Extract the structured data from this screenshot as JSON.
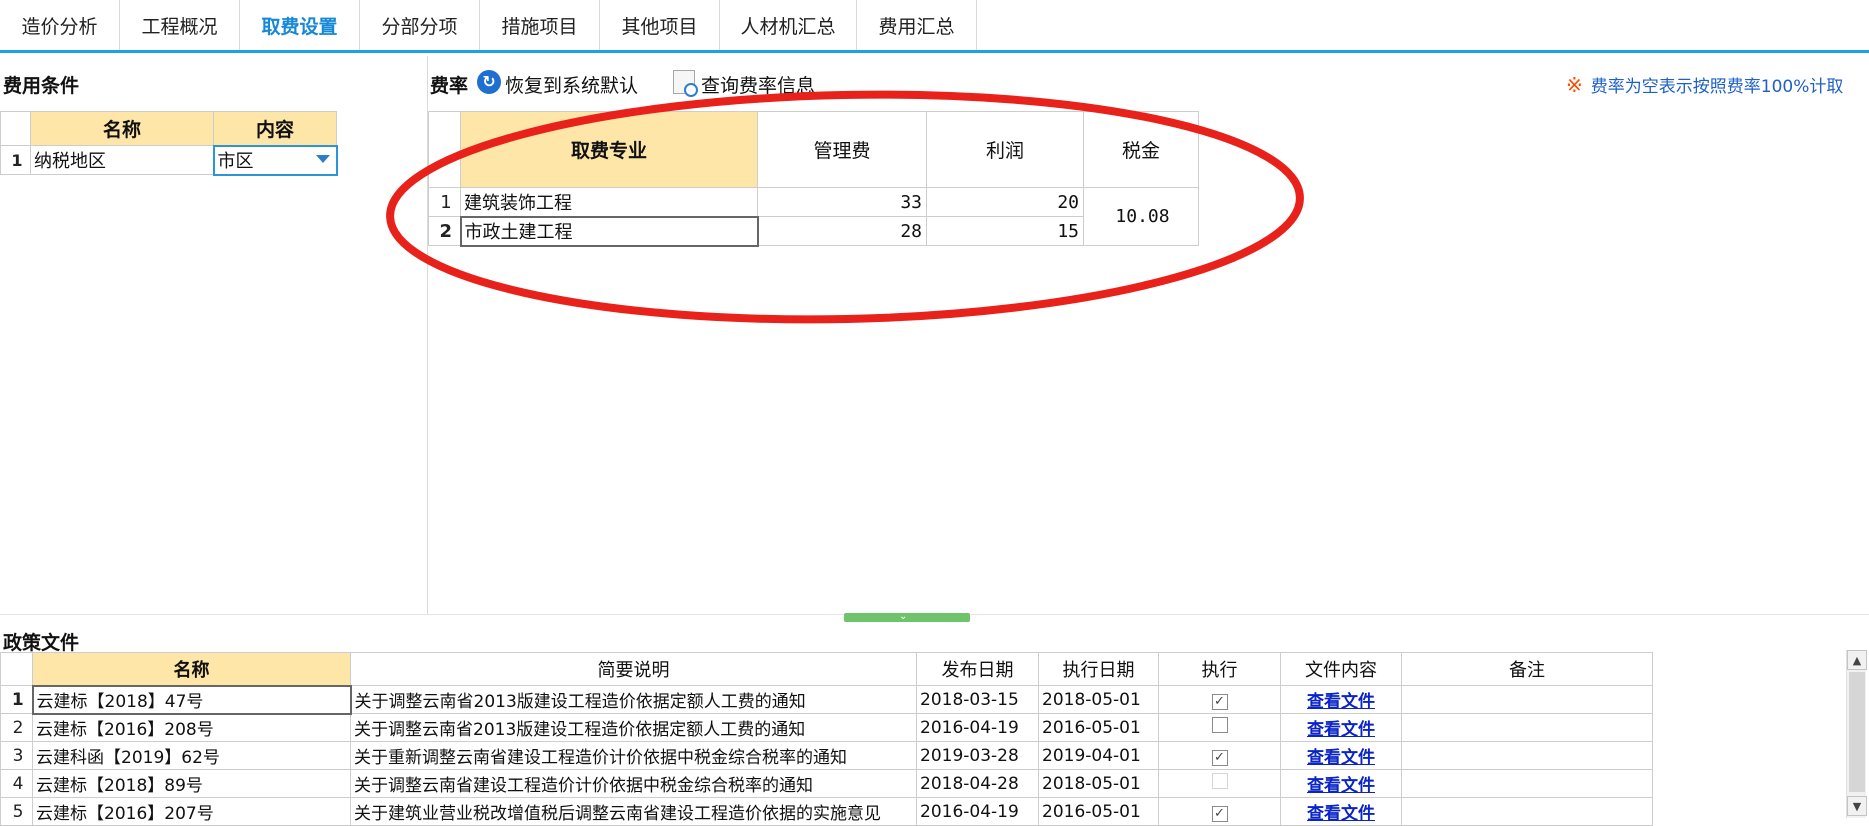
{
  "tabs": [
    {
      "label": "造价分析"
    },
    {
      "label": "工程概况"
    },
    {
      "label": "取费设置"
    },
    {
      "label": "分部分项"
    },
    {
      "label": "措施项目"
    },
    {
      "label": "其他项目"
    },
    {
      "label": "人材机汇总"
    },
    {
      "label": "费用汇总"
    }
  ],
  "active_tab": "取费设置",
  "conditions": {
    "title": "费用条件",
    "headers": {
      "name": "名称",
      "content": "内容"
    },
    "rows": [
      {
        "num": "1",
        "name": "纳税地区",
        "content": "市区"
      }
    ]
  },
  "rates": {
    "title": "费率",
    "reset_label": "恢复到系统默认",
    "query_label": "查询费率信息",
    "note_mark": "※",
    "note": "费率为空表示按照费率100%计取",
    "headers": {
      "specialty": "取费专业",
      "mgmt": "管理费",
      "profit": "利润",
      "tax": "税金"
    },
    "rows": [
      {
        "num": "1",
        "specialty": "建筑装饰工程",
        "mgmt": "33",
        "profit": "20"
      },
      {
        "num": "2",
        "specialty": "市政土建工程",
        "mgmt": "28",
        "profit": "15"
      }
    ],
    "tax_value": "10.08"
  },
  "policy": {
    "title": "政策文件",
    "headers": {
      "name": "名称",
      "summary": "简要说明",
      "publish": "发布日期",
      "effective": "执行日期",
      "execute": "执行",
      "content": "文件内容",
      "remark": "备注"
    },
    "rows": [
      {
        "num": "1",
        "name": "云建标【2018】47号",
        "summary": "关于调整云南省2013版建设工程造价依据定额人工费的通知",
        "publish": "2018-03-15",
        "effective": "2018-05-01",
        "executed": "checked",
        "link": "查看文件"
      },
      {
        "num": "2",
        "name": "云建标【2016】208号",
        "summary": "关于调整云南省2013版建设工程造价依据定额人工费的通知",
        "publish": "2016-04-19",
        "effective": "2016-05-01",
        "executed": "unchecked",
        "link": "查看文件"
      },
      {
        "num": "3",
        "name": "云建科函【2019】62号",
        "summary": "关于重新调整云南省建设工程造价计价依据中税金综合税率的通知",
        "publish": "2019-03-28",
        "effective": "2019-04-01",
        "executed": "checked",
        "link": "查看文件"
      },
      {
        "num": "4",
        "name": "云建标【2018】89号",
        "summary": "关于调整云南省建设工程造价计价依据中税金综合税率的通知",
        "publish": "2018-04-28",
        "effective": "2018-05-01",
        "executed": "disabled",
        "link": "查看文件"
      },
      {
        "num": "5",
        "name": "云建标【2016】207号",
        "summary": "关于建筑业营业税改增值税后调整云南省建设工程造价依据的实施意见",
        "publish": "2016-04-19",
        "effective": "2016-05-01",
        "executed": "checked",
        "link": "查看文件"
      }
    ]
  },
  "colors": {
    "accent": "#1ea0e6",
    "header_yellow": "#fde6a8",
    "annotation_red": "#e8211b",
    "link": "#0b24c8"
  }
}
